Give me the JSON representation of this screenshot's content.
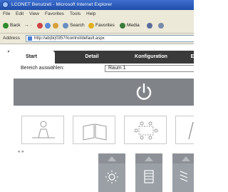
{
  "browser": {
    "title": "LCONET Benutzeli - Microsoft Internet Explorer",
    "menu": [
      "File",
      "Edit",
      "View",
      "Favorites",
      "Tools",
      "Help"
    ],
    "toolbar": {
      "back": "Back",
      "search": "Search",
      "favorites": "Favorites",
      "media": "Media"
    },
    "address_label": "Address",
    "address_value": "http://ab(bi)0357/lcontrol/default.aspx"
  },
  "app": {
    "tabs": [
      "Start",
      "Detail",
      "Konfiguration",
      "E"
    ],
    "active_tab": "Start",
    "area_label": "Bereich auswählen:",
    "area_value": "Raum 1",
    "pager_arrows": "« »",
    "scenes": [
      "person-at-desk-icon",
      "open-book-icon",
      "meeting-table-icon",
      "presentation-icon"
    ],
    "controls": [
      "light-icon",
      "blind-icon",
      "louvre-icon"
    ],
    "colors": {
      "tab_bar": "#3a3a3a",
      "power_bar": "#808489",
      "control_panel": "#9aa0a6"
    }
  }
}
